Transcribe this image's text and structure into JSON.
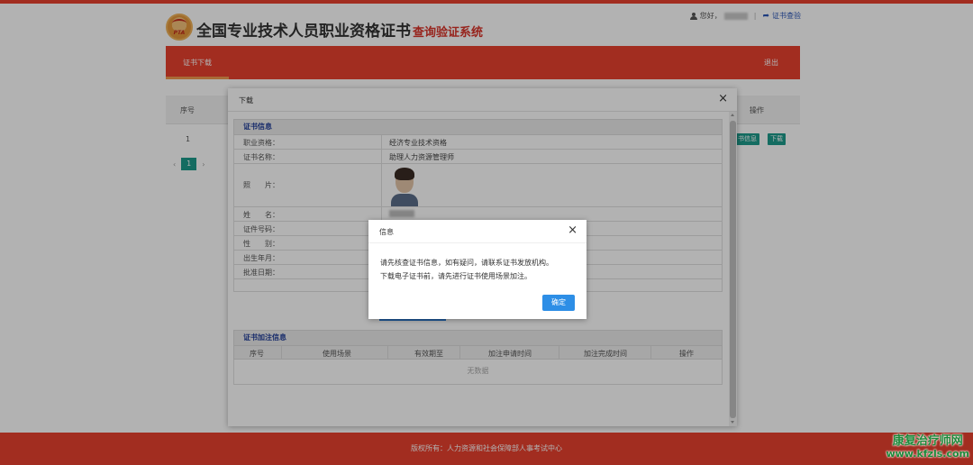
{
  "header": {
    "logo_text": "PTA",
    "title_main": "全国专业技术人员职业资格证书",
    "title_sub": "查询验证系统",
    "greeting": "您好，",
    "separator": "|",
    "verify_link": "证书查验"
  },
  "nav": {
    "active_tab": "证书下载",
    "logout": "退出"
  },
  "table": {
    "col_index": "序号",
    "col_action": "操作",
    "rows": [
      {
        "index": "1",
        "btn_info": "书信息",
        "btn_download": "下载"
      }
    ]
  },
  "pager": {
    "prev": "‹",
    "current": "1",
    "next": "›"
  },
  "download_modal": {
    "title": "下载",
    "close": "×",
    "section_cert": "证书信息",
    "fields": [
      {
        "label": "职业资格：",
        "value": "经济专业技术资格"
      },
      {
        "label": "证书名称：",
        "value": "助理人力资源管理师"
      },
      {
        "label": "照　　片：",
        "value": ""
      },
      {
        "label": "姓　　名：",
        "value": ""
      },
      {
        "label": "证件号码：",
        "value": ""
      },
      {
        "label": "性　　别：",
        "value": ""
      },
      {
        "label": "出生年月：",
        "value": ""
      },
      {
        "label": "批准日期：",
        "value": ""
      }
    ],
    "section_extra": "证书加注信息",
    "extra_columns": [
      "序号",
      "使用场景",
      "有效期至",
      "加注申请时间",
      "加注完成时间",
      "操作"
    ],
    "no_data": "无数据"
  },
  "info_dialog": {
    "title": "信息",
    "close": "×",
    "line1": "请先核查证书信息，如有疑问，请联系证书发放机构。",
    "line2": "下载电子证书前，请先进行证书使用场景加注。",
    "ok": "确定"
  },
  "footer": {
    "text": "版权所有：人力资源和社会保障部人事考试中心"
  },
  "watermark": {
    "line1": "康复治疗师网",
    "line2": "www.kfzls.com"
  },
  "colors": {
    "brand_red": "#e8412f",
    "teal": "#1d9b8b",
    "blue": "#2d8ee6"
  }
}
